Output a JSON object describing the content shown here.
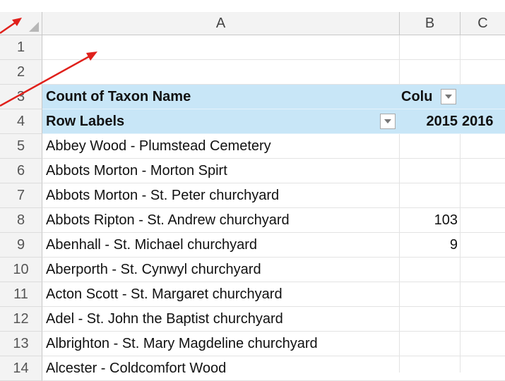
{
  "columns": {
    "a": "A",
    "b": "B",
    "c": "C"
  },
  "rows": [
    {
      "num": "1",
      "a": "",
      "b": "",
      "c": ""
    },
    {
      "num": "2",
      "a": "",
      "b": "",
      "c": ""
    },
    {
      "num": "3",
      "a": "Count of Taxon Name",
      "b": "Colu",
      "c": ""
    },
    {
      "num": "4",
      "a": "Row Labels",
      "b": "2015",
      "c": "2016"
    },
    {
      "num": "5",
      "a": "Abbey Wood - Plumstead Cemetery",
      "b": "",
      "c": ""
    },
    {
      "num": "6",
      "a": "Abbots Morton - Morton Spirt",
      "b": "",
      "c": ""
    },
    {
      "num": "7",
      "a": "Abbots Morton - St. Peter churchyard",
      "b": "",
      "c": ""
    },
    {
      "num": "8",
      "a": "Abbots Ripton - St. Andrew churchyard",
      "b": "103",
      "c": ""
    },
    {
      "num": "9",
      "a": "Abenhall - St. Michael churchyard",
      "b": "9",
      "c": ""
    },
    {
      "num": "10",
      "a": "Aberporth - St. Cynwyl churchyard",
      "b": "",
      "c": ""
    },
    {
      "num": "11",
      "a": "Acton Scott - St. Margaret churchyard",
      "b": "",
      "c": ""
    },
    {
      "num": "12",
      "a": "Adel - St. John the Baptist churchyard",
      "b": "",
      "c": ""
    },
    {
      "num": "13",
      "a": "Albrighton - St. Mary Magdeline churchyard",
      "b": "",
      "c": ""
    },
    {
      "num": "14",
      "a": "Alcester - Coldcomfort Wood",
      "b": "",
      "c": ""
    }
  ],
  "colors": {
    "pivot_header": "#c8e6f7",
    "annotation_arrow": "#e0201b"
  },
  "icons": {
    "corner": "select-all-triangle-icon",
    "filter": "dropdown-arrow-icon"
  }
}
